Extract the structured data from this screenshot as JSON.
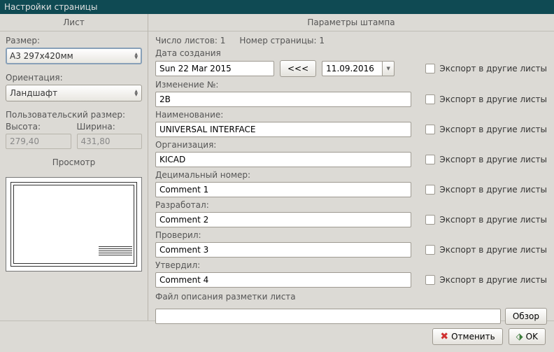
{
  "title": "Настройки страницы",
  "left": {
    "header": "Лист",
    "size_label": "Размер:",
    "size_value": "A3 297x420мм",
    "orient_label": "Ориентация:",
    "orient_value": "Ландшафт",
    "custom_label": "Пользовательский размер:",
    "height_label": "Высота:",
    "height_value": "279,40",
    "width_label": "Ширина:",
    "width_value": "431,80",
    "preview_label": "Просмотр"
  },
  "right": {
    "header": "Параметры штампа",
    "sheet_count": "Число листов: 1",
    "page_num": "Номер страницы: 1",
    "export_label": "Экспорт в другие листы",
    "fields": [
      {
        "label": "Дата создания",
        "value": "Sun 22 Mar 2015",
        "date_btn": "<<<",
        "date_pick": "11.09.2016"
      },
      {
        "label": "Изменение №:",
        "value": "2B"
      },
      {
        "label": "Наименование:",
        "value": "UNIVERSAL INTERFACE"
      },
      {
        "label": "Организация:",
        "value": "KICAD"
      },
      {
        "label": "Децимальный номер:",
        "value": "Comment 1"
      },
      {
        "label": "Разработал:",
        "value": "Comment 2"
      },
      {
        "label": "Проверил:",
        "value": "Comment 3"
      },
      {
        "label": "Утвердил:",
        "value": "Comment 4"
      }
    ],
    "file_label": "Файл описания разметки листа",
    "file_value": "",
    "browse": "Обзор"
  },
  "footer": {
    "cancel": "Отменить",
    "ok": "OK"
  }
}
